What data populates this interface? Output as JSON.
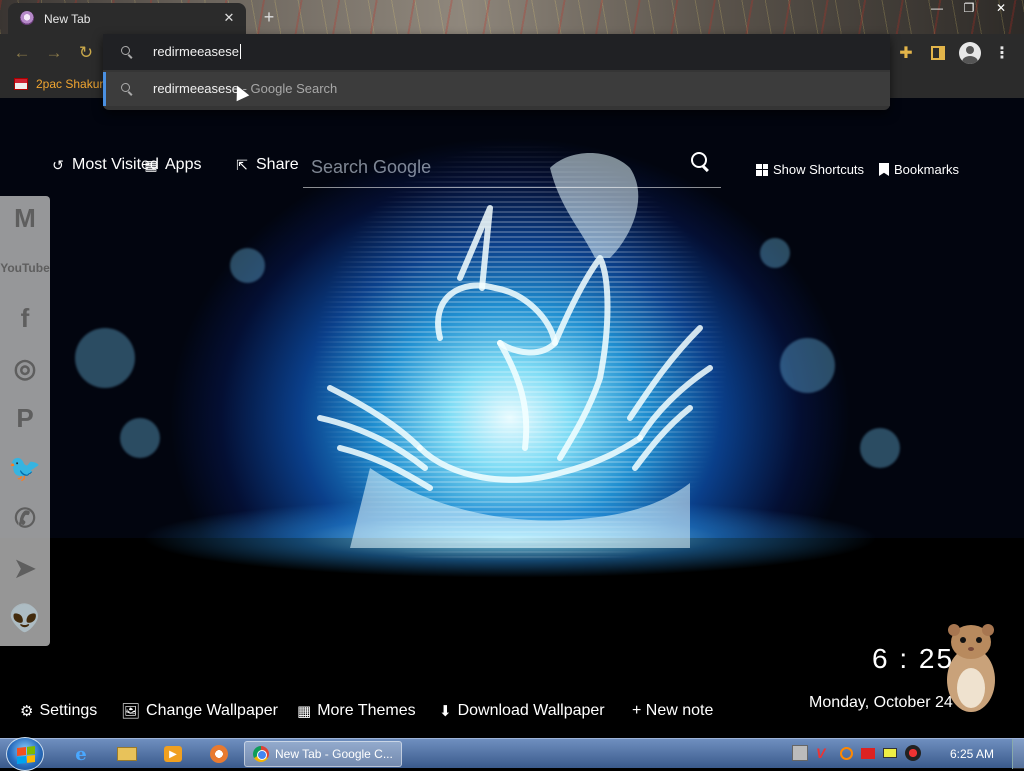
{
  "browser": {
    "tab_title": "New Tab",
    "tab_close": "✕",
    "new_tab": "+",
    "window_controls": {
      "minimize": "—",
      "maximize": "❐",
      "close": "✕"
    },
    "nav": {
      "back": "←",
      "forward": "→",
      "reload": "↻"
    },
    "bookmark_bar": {
      "item_label": "2pac Shakur"
    },
    "omnibox": {
      "query": "redirmeeasese",
      "suggestion_text": "redirmeeasese",
      "suggestion_suffix": " - Google Search"
    }
  },
  "newtab": {
    "top_links": {
      "most_visited": "Most Visited",
      "apps": "Apps",
      "share": "Share"
    },
    "search": {
      "placeholder": "Search Google"
    },
    "right_links": {
      "show_shortcuts": "Show Shortcuts",
      "bookmarks": "Bookmarks"
    },
    "sidebar": [
      {
        "name": "gmail-icon",
        "glyph": "M"
      },
      {
        "name": "youtube-icon",
        "glyph": "YouTube"
      },
      {
        "name": "facebook-icon",
        "glyph": "f"
      },
      {
        "name": "instagram-icon",
        "glyph": "◎"
      },
      {
        "name": "pinterest-icon",
        "glyph": "P"
      },
      {
        "name": "twitter-icon",
        "glyph": "🐦"
      },
      {
        "name": "whatsapp-icon",
        "glyph": "✆"
      },
      {
        "name": "telegram-icon",
        "glyph": "➤"
      },
      {
        "name": "reddit-icon",
        "glyph": "👽"
      }
    ],
    "bottom_links": {
      "settings": "Settings",
      "change_wallpaper": "Change Wallpaper",
      "more_themes": "More Themes",
      "download_wallpaper": "Download Wallpaper",
      "new_note": "+ New note"
    },
    "clock": "6 : 25",
    "date": "Monday, October 24"
  },
  "taskbar": {
    "active_window": "New Tab - Google C...",
    "time": "6:25 AM"
  },
  "colors": {
    "accent_yellow": "#e3b54a",
    "bookmark_orange": "#f0a530",
    "omnibox_highlight": "#4a90e2"
  }
}
